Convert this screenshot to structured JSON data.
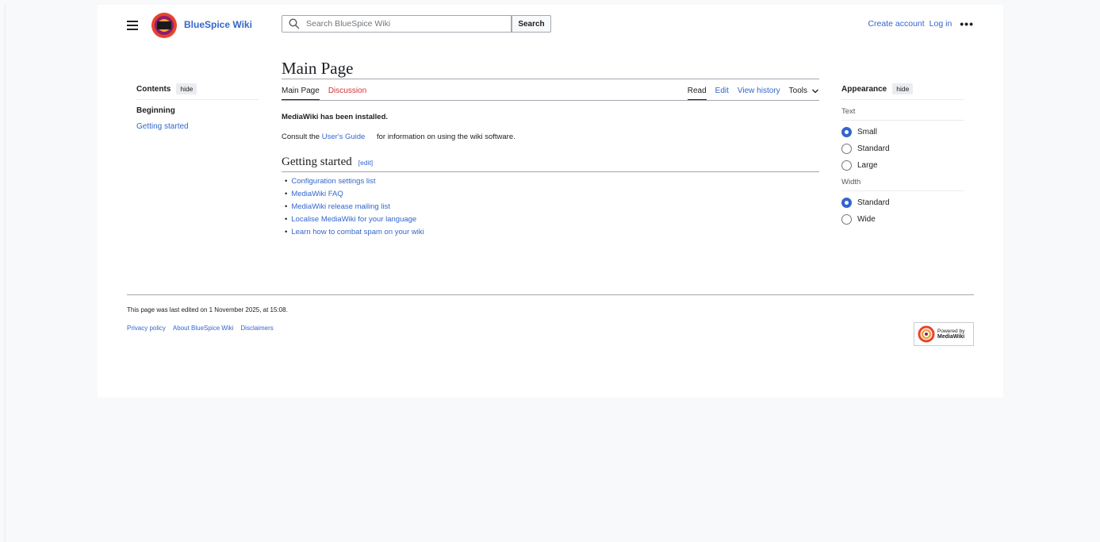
{
  "header": {
    "site_name": "BlueSpice Wiki",
    "search_placeholder": "Search BlueSpice Wiki",
    "search_button": "Search",
    "create_account": "Create account",
    "log_in": "Log in",
    "more": "•••"
  },
  "toc": {
    "title": "Contents",
    "hide": "hide",
    "beginning": "Beginning",
    "items": [
      "Getting started"
    ]
  },
  "page": {
    "title": "Main Page",
    "tabs_left": [
      "Main Page",
      "Discussion"
    ],
    "tabs_right": [
      "Read",
      "Edit",
      "View history"
    ],
    "tools": "Tools",
    "installed": "MediaWiki has been installed.",
    "consult_prefix": "Consult the",
    "consult_link": "User's Guide",
    "consult_suffix": "for information on using the wiki software.",
    "section_title": "Getting started",
    "section_edit": "[edit]",
    "links": [
      "Configuration settings list",
      "MediaWiki FAQ",
      "MediaWiki release mailing list",
      "Localise MediaWiki for your language",
      "Learn how to combat spam on your wiki"
    ]
  },
  "appearance": {
    "title": "Appearance",
    "hide": "hide",
    "text_label": "Text",
    "text_options": [
      "Small",
      "Standard",
      "Large"
    ],
    "text_selected": "Small",
    "width_label": "Width",
    "width_options": [
      "Standard",
      "Wide"
    ],
    "width_selected": "Standard"
  },
  "footer": {
    "last_edited": "This page was last edited on 1 November 2025, at 15:08.",
    "links": [
      "Privacy policy",
      "About BlueSpice Wiki",
      "Disclaimers"
    ],
    "powered_line1": "Powered by",
    "powered_line2": "MediaWiki"
  },
  "colors": {
    "link": "#3366cc",
    "new_link": "#d73333",
    "background": "#f8f9fa"
  }
}
